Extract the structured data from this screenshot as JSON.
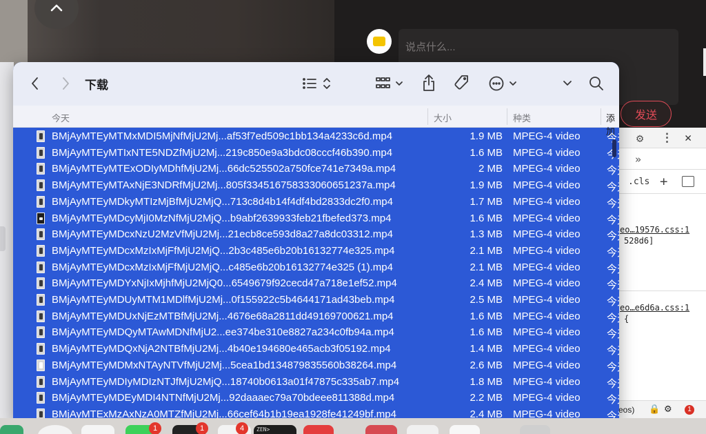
{
  "background": {
    "comment_placeholder": "说点什么...",
    "send_label": "发送"
  },
  "devtools": {
    "cls_label": ".cls",
    "plus_label": "+",
    "more_label": "»",
    "rules": [
      {
        "source": "eo…19576.css:1",
        "value": "528d6]"
      },
      {
        "source": "eo…e6d6a.css:1",
        "value": "{"
      }
    ],
    "footer_text": "eos)",
    "error_count": "1"
  },
  "finder": {
    "title": "下载",
    "columns": {
      "name": "今天",
      "size": "大小",
      "kind": "种类",
      "added": "添加"
    },
    "files": [
      {
        "name": "BMjAyMTEyMTMxMDI5MjNfMjU2Mj...af53f7ed509c1bb134a4233c6d.mp4",
        "size": "1.9 MB",
        "kind": "MPEG-4 video",
        "added": "今天",
        "icon": "thumb"
      },
      {
        "name": "BMjAyMTEyMTIxNTE5NDZfMjU2Mj...219c850e9a3bdc08cccf46b390.mp4",
        "size": "1.6 MB",
        "kind": "MPEG-4 video",
        "added": "今天",
        "icon": "thumb"
      },
      {
        "name": "BMjAyMTEyMTExODIyMDhfMjU2Mj...66dc525502a750fce741e7349a.mp4",
        "size": "2 MB",
        "kind": "MPEG-4 video",
        "added": "今天",
        "icon": "thumb"
      },
      {
        "name": "BMjAyMTEyMTAxNjE3NDRfMjU2Mj...805f33451675833306065​1237a.mp4",
        "size": "1.9 MB",
        "kind": "MPEG-4 video",
        "added": "今天",
        "icon": "thumb"
      },
      {
        "name": "BMjAyMTEyMDkyMTIzMjBfMjU2MjQ...713c8d4b14f4df4bd2833dc2f0.mp4",
        "size": "1.7 MB",
        "kind": "MPEG-4 video",
        "added": "今天",
        "icon": "thumb"
      },
      {
        "name": "BMjAyMTEyMDcyMjI0MzNfMjU2MjQ...b9abf2639933feb21fbefed373.mp4",
        "size": "1.6 MB",
        "kind": "MPEG-4 video",
        "added": "今天",
        "icon": "dark"
      },
      {
        "name": "BMjAyMTEyMDcxNzU2MzVfMjU2Mj...21ecb8ce593d8a27a8dc03312.mp4",
        "size": "1.3 MB",
        "kind": "MPEG-4 video",
        "added": "今天",
        "icon": "thumb"
      },
      {
        "name": "BMjAyMTEyMDcxMzIxMjFfMjU2MjQ...2b3c485e6b20b16132774e325.mp4",
        "size": "2.1 MB",
        "kind": "MPEG-4 video",
        "added": "今天",
        "icon": "thumb"
      },
      {
        "name": "BMjAyMTEyMDcxMzIxMjFfMjU2MjQ...c485e6b20b16132774e325 (1).mp4",
        "size": "2.1 MB",
        "kind": "MPEG-4 video",
        "added": "今天",
        "icon": "thumb"
      },
      {
        "name": "BMjAyMTEyMDYxNjIxMjhfMjU2MjQ0...6549679f92cecd47a718e1ef52.mp4",
        "size": "2.4 MB",
        "kind": "MPEG-4 video",
        "added": "今天",
        "icon": "thumb"
      },
      {
        "name": "BMjAyMTEyMDUyMTM1MDlfMjU2Mj...0f155922c5b4644171ad43beb.mp4",
        "size": "2.5 MB",
        "kind": "MPEG-4 video",
        "added": "今天",
        "icon": "thumb"
      },
      {
        "name": "BMjAyMTEyMDUxNjEzMTBfMjU2Mj...4676e68a2811dd49169700621.mp4",
        "size": "1.6 MB",
        "kind": "MPEG-4 video",
        "added": "今天",
        "icon": "thumb"
      },
      {
        "name": "BMjAyMTEyMDQyMTAwMDNfMjU2...ee374be310e8827a234c0fb94a.mp4",
        "size": "1.6 MB",
        "kind": "MPEG-4 video",
        "added": "今天",
        "icon": "thumb"
      },
      {
        "name": "BMjAyMTEyMDQxNjA2NTBfMjU2Mj...4b40e194680e465acb3f05192.mp4",
        "size": "1.4 MB",
        "kind": "MPEG-4 video",
        "added": "今天",
        "icon": "thumb"
      },
      {
        "name": "BMjAyMTEyMDMxNTAyNTVfMjU2Mj...5cea1bd134879835560b38264.mp4",
        "size": "2.6 MB",
        "kind": "MPEG-4 video",
        "added": "今天",
        "icon": "white"
      },
      {
        "name": "BMjAyMTEyMDIyMDIzNTJfMjU2MjQ...18740b0613a01f47875c335ab7.mp4",
        "size": "1.8 MB",
        "kind": "MPEG-4 video",
        "added": "今天",
        "icon": "thumb"
      },
      {
        "name": "BMjAyMTEyMDEyMDI4NTNfMjU2Mj...92daaaec79a70bdeee811388d.mp4",
        "size": "2.2 MB",
        "kind": "MPEG-4 video",
        "added": "今天",
        "icon": "thumb"
      },
      {
        "name": "BMjAyMTExMzAxNzA0MTZfMjU2Mj...66cef64b1b19ea1928fe41249bf.mp4",
        "size": "2.4 MB",
        "kind": "MPEG-4 video",
        "added": "今天",
        "icon": "thumb"
      }
    ]
  },
  "dock": {
    "badges": [
      "1",
      "1",
      "4"
    ],
    "terminal_label": "ZEN>"
  },
  "colors": {
    "selection": "#2c59d6",
    "toolbar": "#e9ecf6",
    "send_accent": "#e14b57",
    "badge": "#e3362c"
  }
}
